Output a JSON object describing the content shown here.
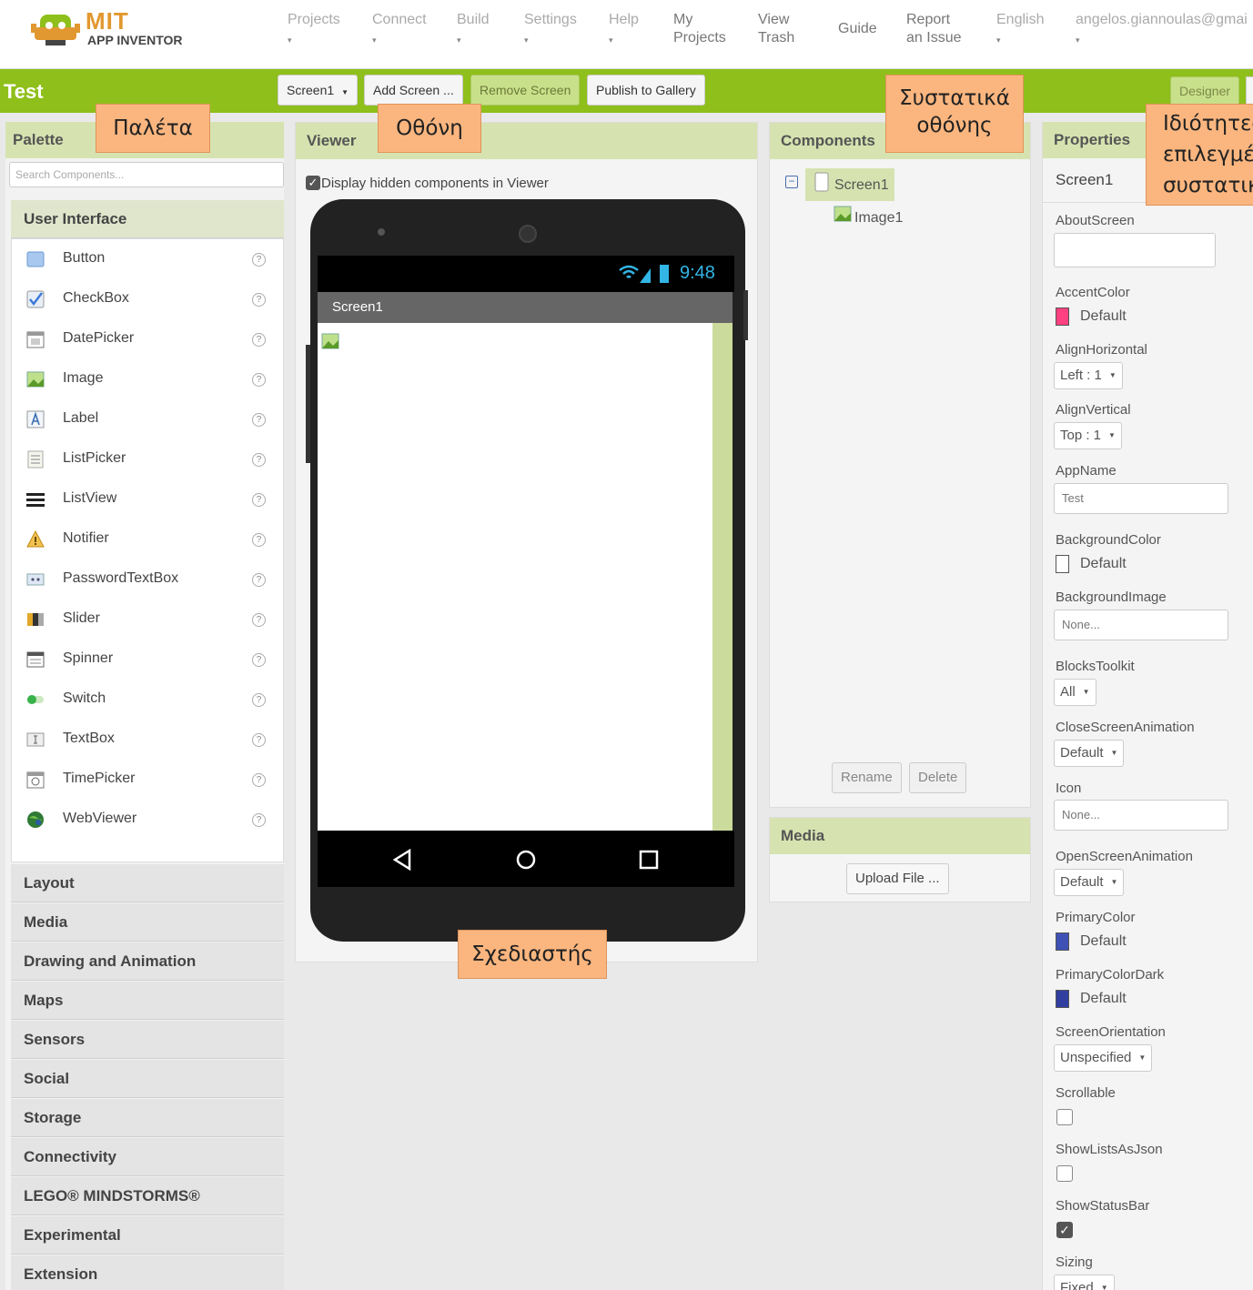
{
  "header": {
    "logo_title": "MIT",
    "logo_subtitle": "APP INVENTOR",
    "nav": [
      {
        "label": "Projects",
        "caret": "▾"
      },
      {
        "label": "Connect",
        "caret": "▾"
      },
      {
        "label": "Build",
        "caret": "▾"
      },
      {
        "label": "Settings",
        "caret": "▾"
      },
      {
        "label": "Help",
        "caret": "▾"
      },
      {
        "label": "My\nProjects"
      },
      {
        "label": "View\nTrash"
      },
      {
        "label": "Guide"
      },
      {
        "label": "Report\nan Issue"
      },
      {
        "label": "English",
        "caret": "▾"
      },
      {
        "label": "angelos.giannoulas@gmai",
        "caret": "▾"
      }
    ]
  },
  "toolbar": {
    "project_name": "Test",
    "screen_select": "Screen1",
    "add_screen": "Add Screen ...",
    "remove_screen": "Remove Screen",
    "publish": "Publish to Gallery",
    "designer": "Designer"
  },
  "callouts": {
    "palette": "Παλέτα",
    "screen": "Οθόνη",
    "screen_components": "Συστατικά\nοθόνης",
    "properties": "Ιδιότητες\nεπιλεγμέν\nσυστατικο",
    "designer": "Σχεδιαστής"
  },
  "palette": {
    "title": "Palette",
    "search_placeholder": "Search Components...",
    "open_category": "User Interface",
    "items": [
      {
        "label": "Button",
        "icon": "button-icon"
      },
      {
        "label": "CheckBox",
        "icon": "checkbox-icon"
      },
      {
        "label": "DatePicker",
        "icon": "datepicker-icon"
      },
      {
        "label": "Image",
        "icon": "image-icon"
      },
      {
        "label": "Label",
        "icon": "label-icon"
      },
      {
        "label": "ListPicker",
        "icon": "listpicker-icon"
      },
      {
        "label": "ListView",
        "icon": "listview-icon"
      },
      {
        "label": "Notifier",
        "icon": "notifier-icon"
      },
      {
        "label": "PasswordTextBox",
        "icon": "password-icon"
      },
      {
        "label": "Slider",
        "icon": "slider-icon"
      },
      {
        "label": "Spinner",
        "icon": "spinner-icon"
      },
      {
        "label": "Switch",
        "icon": "switch-icon"
      },
      {
        "label": "TextBox",
        "icon": "textbox-icon"
      },
      {
        "label": "TimePicker",
        "icon": "timepicker-icon"
      },
      {
        "label": "WebViewer",
        "icon": "webviewer-icon"
      }
    ],
    "help_glyph": "?",
    "categories": [
      "Layout",
      "Media",
      "Drawing and Animation",
      "Maps",
      "Sensors",
      "Social",
      "Storage",
      "Connectivity",
      "LEGO® MINDSTORMS®",
      "Experimental",
      "Extension"
    ]
  },
  "viewer": {
    "title": "Viewer",
    "hidden_checkbox_label": "Display hidden components in Viewer",
    "status_time": "9:48",
    "screen_title": "Screen1"
  },
  "components": {
    "title": "Components",
    "root": "Screen1",
    "child": "Image1",
    "rename": "Rename",
    "delete": "Delete"
  },
  "media": {
    "title": "Media",
    "upload": "Upload File ..."
  },
  "properties": {
    "title": "Properties",
    "selected": "Screen1",
    "about_screen": "AboutScreen",
    "accent_color": "AccentColor",
    "accent_color_value": "Default",
    "align_horizontal": "AlignHorizontal",
    "align_horizontal_value": "Left : 1",
    "align_vertical": "AlignVertical",
    "align_vertical_value": "Top : 1",
    "app_name": "AppName",
    "app_name_value": "Test",
    "background_color": "BackgroundColor",
    "background_color_value": "Default",
    "background_image": "BackgroundImage",
    "background_image_value": "None...",
    "blocks_toolkit": "BlocksToolkit",
    "blocks_toolkit_value": "All",
    "close_screen_animation": "CloseScreenAnimation",
    "close_screen_animation_value": "Default",
    "icon": "Icon",
    "icon_value": "None...",
    "open_screen_animation": "OpenScreenAnimation",
    "open_screen_animation_value": "Default",
    "primary_color": "PrimaryColor",
    "primary_color_value": "Default",
    "primary_color_dark": "PrimaryColorDark",
    "primary_color_dark_value": "Default",
    "screen_orientation": "ScreenOrientation",
    "screen_orientation_value": "Unspecified",
    "scrollable": "Scrollable",
    "scrollable_checked": false,
    "show_lists_as_json": "ShowListsAsJson",
    "show_lists_as_json_checked": false,
    "show_status_bar": "ShowStatusBar",
    "show_status_bar_checked": true,
    "sizing": "Sizing",
    "sizing_value": "Fixed"
  },
  "colors": {
    "accent_swatch": "#ff4081",
    "background_swatch": "#ffffff",
    "primary_swatch": "#3f51b5",
    "primary_dark_swatch": "#303f9f",
    "green_bar": "#8fbf1b",
    "panel_header": "#d6e3b0",
    "callout": "#fbb67f"
  }
}
